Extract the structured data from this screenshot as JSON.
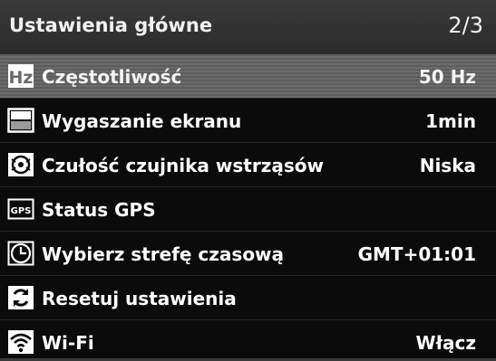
{
  "header": {
    "title": "Ustawienia główne",
    "page_indicator": "2/3"
  },
  "menu": {
    "items": [
      {
        "icon": "hz-icon",
        "label": "Częstotliwość",
        "value": "50 Hz",
        "selected": true
      },
      {
        "icon": "screen-blank-icon",
        "label": "Wygaszanie ekranu",
        "value": "1min",
        "selected": false
      },
      {
        "icon": "shock-sensor-icon",
        "label": "Czułość czujnika wstrząsów",
        "value": "Niska",
        "selected": false
      },
      {
        "icon": "gps-icon",
        "label": "Status GPS",
        "value": "",
        "selected": false
      },
      {
        "icon": "clock-icon",
        "label": "Wybierz strefę czasową",
        "value": "GMT+01:01",
        "selected": false
      },
      {
        "icon": "reset-icon",
        "label": "Resetuj ustawienia",
        "value": "",
        "selected": false
      },
      {
        "icon": "wifi-icon",
        "label": "Wi-Fi",
        "value": "Włącz",
        "selected": false
      }
    ]
  },
  "colors": {
    "header_bg": "#2f2f2f",
    "menu_bg": "#0b0b0b",
    "selected_bg": "#646464",
    "text": "#ffffff"
  }
}
